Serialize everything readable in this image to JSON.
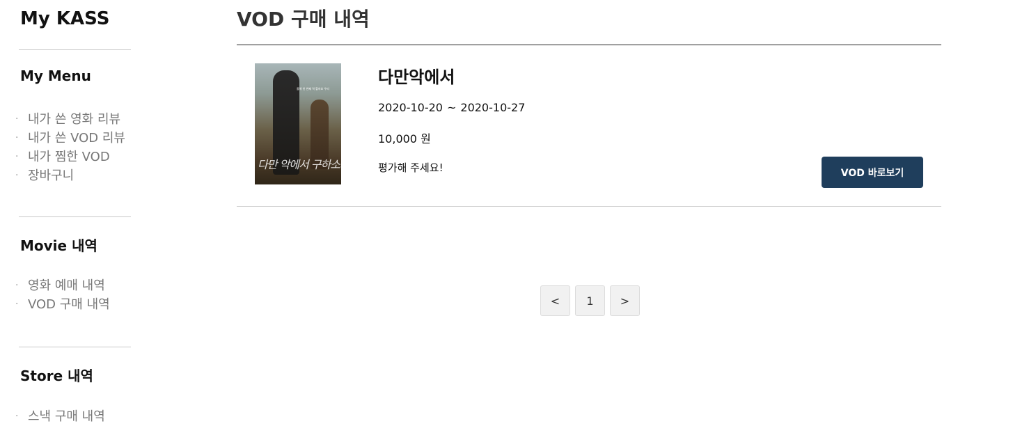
{
  "sidebar": {
    "brand": "My KASS",
    "sections": [
      {
        "title": "My Menu",
        "items": [
          "내가 쓴 영화 리뷰",
          "내가 쓴 VOD 리뷰",
          "내가 찜한 VOD",
          "장바구니"
        ]
      },
      {
        "title": "Movie 내역",
        "items": [
          "영화 예매 내역",
          "VOD 구매 내역"
        ]
      },
      {
        "title": "Store 내역",
        "items": [
          "스낵 구매 내역"
        ]
      }
    ]
  },
  "main": {
    "page_title": "VOD 구매 내역",
    "purchases": [
      {
        "title": "다만악에서",
        "start_date": "2020-10-20",
        "period_separator": "~",
        "end_date": "2020-10-27",
        "price": "10,000 원",
        "rate_link": "평가해 주세요!",
        "watch_button": "VOD 바로보기",
        "poster": {
          "title_text": "다만 악에서 구하소서",
          "tagline": "올해 첫 번째 역 할까요 우리"
        }
      }
    ],
    "pagination": {
      "prev": "<",
      "current": "1",
      "next": ">"
    }
  },
  "colors": {
    "accent_button": "#1f3e5c",
    "menu_text": "#777777",
    "divider": "#c9c9c9"
  }
}
